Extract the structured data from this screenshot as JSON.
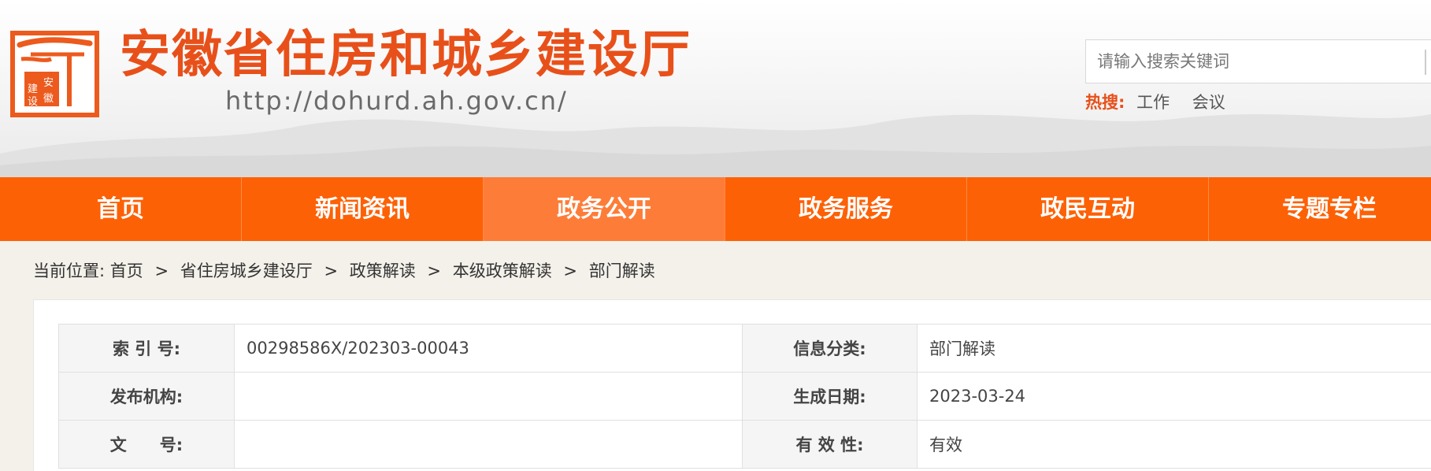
{
  "header": {
    "site_title": "安徽省住房和城乡建设厅",
    "site_url": "http://dohurd.ah.gov.cn/",
    "logo_text": [
      "安",
      "徽",
      "建",
      "设"
    ],
    "search_placeholder": "请输入搜索关键词",
    "hot_label": "热搜:",
    "hot_links": [
      "工作",
      "会议"
    ]
  },
  "nav": {
    "items": [
      {
        "label": "首页"
      },
      {
        "label": "新闻资讯"
      },
      {
        "label": "政务公开"
      },
      {
        "label": "政务服务"
      },
      {
        "label": "政民互动"
      },
      {
        "label": "专题专栏"
      }
    ],
    "active_index": 2
  },
  "breadcrumb": {
    "prefix": "当前位置:",
    "items": [
      "首页",
      "省住房城乡建设厅",
      "政策解读",
      "本级政策解读",
      "部门解读"
    ],
    "separator": ">"
  },
  "info_table": {
    "rows": [
      {
        "label1": "索 引 号:",
        "value1": "00298586X/202303-00043",
        "label2": "信息分类:",
        "value2": "部门解读"
      },
      {
        "label1": "发布机构:",
        "value1": "",
        "label2": "生成日期:",
        "value2": "2023-03-24"
      },
      {
        "label1": "文　　号:",
        "value1": "",
        "label2": "有 效 性:",
        "value2": "有效"
      }
    ]
  },
  "colors": {
    "brand_orange": "#fd6105",
    "nav_active": "#fd7d38",
    "title_orange": "#e8501a"
  }
}
